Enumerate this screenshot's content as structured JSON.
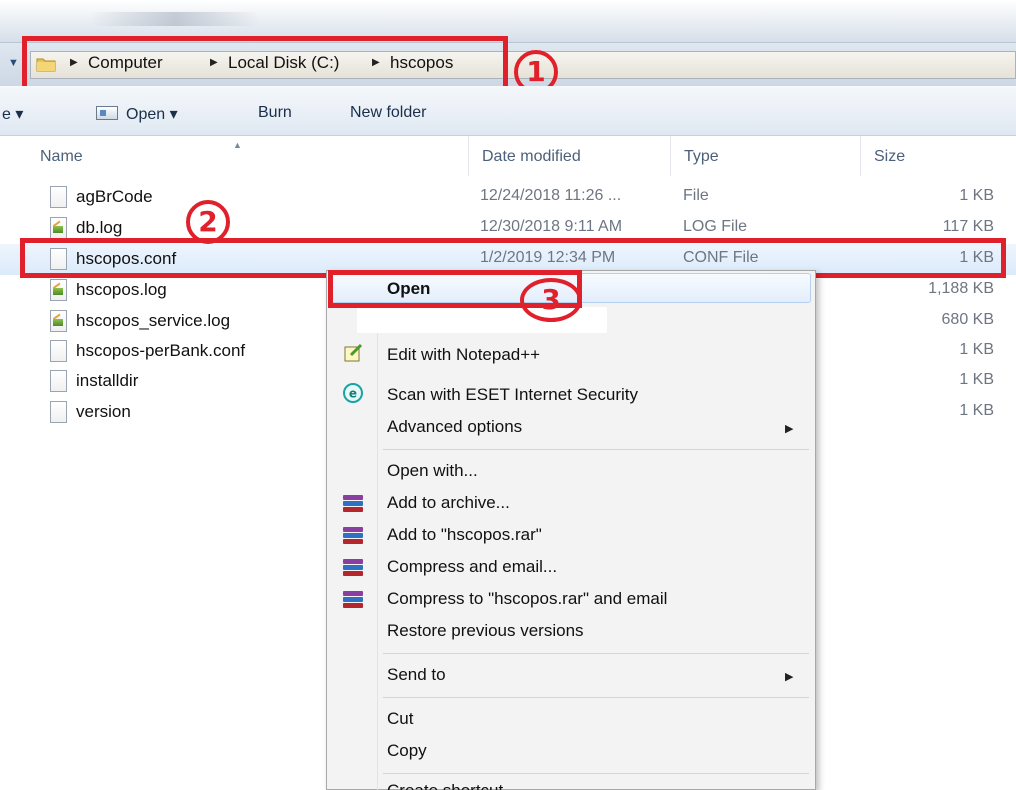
{
  "address": {
    "crumbs": [
      "Computer",
      "Local Disk (C:)",
      "hscopos"
    ]
  },
  "toolbar": {
    "partial_left": "e",
    "open_label": "Open",
    "burn_label": "Burn",
    "new_folder_label": "New folder"
  },
  "columns": {
    "name": "Name",
    "date": "Date modified",
    "type": "Type",
    "size": "Size"
  },
  "files": [
    {
      "name": "agBrCode",
      "date": "12/24/2018 11:26 ...",
      "type": "File",
      "size": "1 KB",
      "icon": "file-icon"
    },
    {
      "name": "db.log",
      "date": "12/30/2018 9:11 AM",
      "type": "LOG File",
      "size": "117 KB",
      "icon": "log-file-icon"
    },
    {
      "name": "hscopos.conf",
      "date": "1/2/2019 12:34 PM",
      "type": "CONF File",
      "size": "1 KB",
      "icon": "file-icon"
    },
    {
      "name": "hscopos.log",
      "date": "",
      "type": "",
      "size": "1,188 KB",
      "icon": "log-file-icon"
    },
    {
      "name": "hscopos_service.log",
      "date": "",
      "type": "",
      "size": "680 KB",
      "icon": "log-file-icon"
    },
    {
      "name": "hscopos-perBank.conf",
      "date": "",
      "type": "",
      "size": "1 KB",
      "icon": "file-icon"
    },
    {
      "name": "installdir",
      "date": "",
      "type": "",
      "size": "1 KB",
      "icon": "file-icon"
    },
    {
      "name": "version",
      "date": "",
      "type": "",
      "size": "1 KB",
      "icon": "file-icon"
    }
  ],
  "context_menu": {
    "open": "Open",
    "edit_notepad": "Edit with Notepad++",
    "scan_eset": "Scan with ESET Internet Security",
    "advanced": "Advanced options",
    "open_with": "Open with...",
    "add_archive": "Add to archive...",
    "add_rar": "Add to \"hscopos.rar\"",
    "compress_email": "Compress and email...",
    "compress_rar_email": "Compress to \"hscopos.rar\" and email",
    "restore": "Restore previous versions",
    "send_to": "Send to",
    "cut": "Cut",
    "copy": "Copy",
    "create_shortcut": "Create shortcut"
  },
  "annotations": {
    "step1": "1",
    "step2": "2",
    "step3": "3"
  },
  "colors": {
    "annotation_red": "#e0202a",
    "selection_blue": "#dbeafa"
  }
}
